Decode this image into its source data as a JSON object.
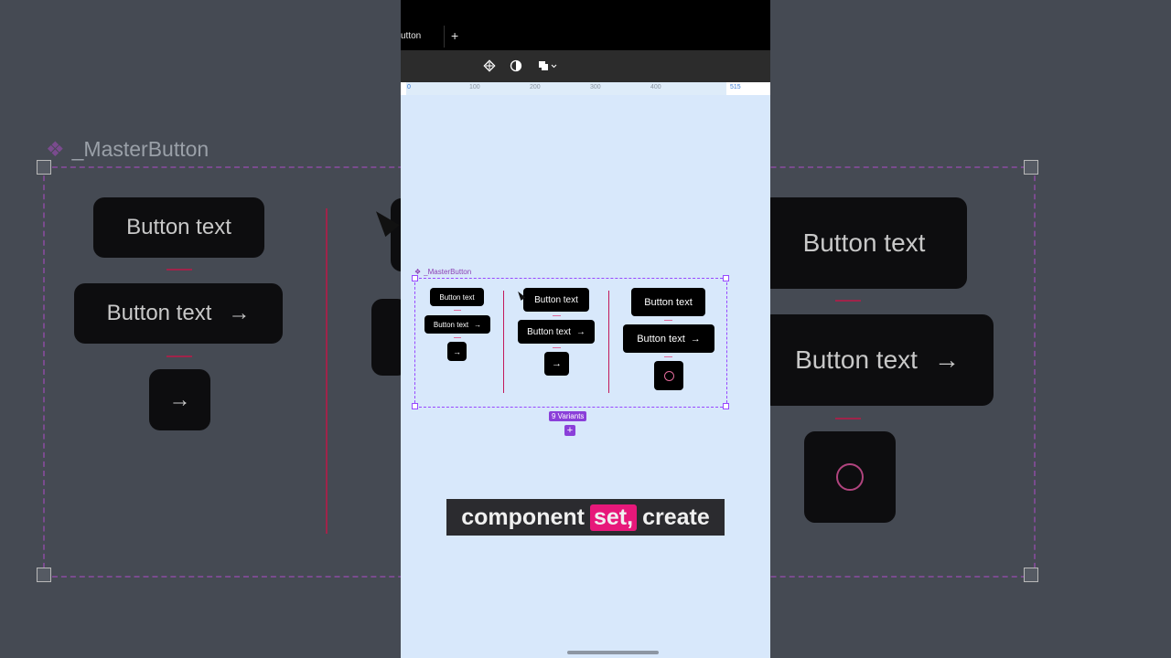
{
  "background": {
    "component_label": "_MasterButton",
    "button_text": "Button text",
    "arrow": "→"
  },
  "tabs": {
    "current_tab": "utton",
    "new_tab": "+"
  },
  "toolbar": {
    "component_icon": "component-icon",
    "contrast_icon": "contrast-icon",
    "boolean_icon": "boolean-ops-icon"
  },
  "ruler": {
    "ticks": [
      "0",
      "100",
      "200",
      "300",
      "400",
      "515"
    ]
  },
  "component_set": {
    "label": "_MasterButton",
    "button_text": "Button text",
    "arrow": "→",
    "variants_badge": "9 Variants",
    "add_label": "+"
  },
  "caption": {
    "words": [
      "component",
      "set,",
      "create"
    ],
    "highlighted_index": 1,
    "highlight_color": "#e7187a"
  },
  "colors": {
    "canvas": "#d8e8fb",
    "accent_purple": "#9747ff",
    "separator_red": "#c2185b"
  }
}
